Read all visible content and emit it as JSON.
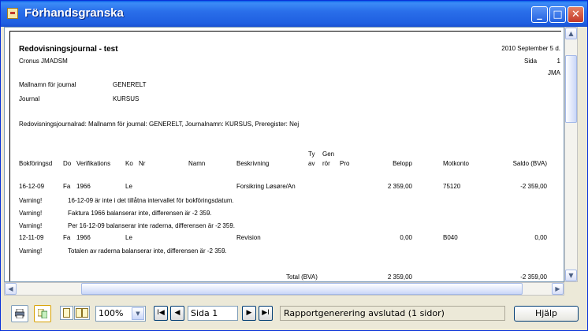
{
  "window": {
    "title": "Förhandsgranska",
    "min_label": "_",
    "max_label": "□",
    "close_label": "✕"
  },
  "report": {
    "title": "Redovisningsjournal - test",
    "company": "Cronus JMADSM",
    "date": "2010 September 5 d.",
    "page_label": "Sida",
    "page_number": "1",
    "user": "JMA",
    "template_label": "Mallnamn för journal",
    "template_value": "GENERELT",
    "journal_label": "Journal",
    "journal_value": "KURSUS",
    "filter": "Redovisningsjournalrad: Mallnamn för journal: GENERELT, Journalnamn: KURSUS, Preregister: Nej",
    "headers": {
      "date": "Bokföringsd",
      "doc": "Do",
      "verif": "Verifikations",
      "ko": "Ko",
      "nr": "Nr",
      "name": "Namn",
      "desc": "Beskrivning",
      "type_top": "Ty",
      "type_bottom": "av",
      "gen_top": "Gen",
      "gen_bottom": "rör",
      "pro": "Pro",
      "amount": "Belopp",
      "contra": "Motkonto",
      "balance": "Saldo (BVA)"
    },
    "rows": [
      {
        "date": "16-12-09",
        "doc": "Fa",
        "verif": "1966",
        "ko": "Le",
        "desc": "Forsikring Løsøre/An",
        "amount": "2 359,00",
        "contra": "75120",
        "balance": "-2 359,00"
      },
      {
        "date": "12-11-09",
        "doc": "Fa",
        "verif": "1966",
        "ko": "Le",
        "desc": "Revision",
        "amount": "0,00",
        "contra": "B040",
        "balance": "0,00"
      }
    ],
    "warning_label": "Varning!",
    "warnings": [
      "16-12-09 är inte i det tillåtna intervallet för bokföringsdatum.",
      "Faktura 1966 balanserar inte, differensen är -2 359.",
      "Per 16-12-09 balanserar inte raderna, differensen är -2 359.",
      "Totalen av raderna balanserar inte, differensen är -2 359."
    ],
    "total_label": "Total (BVA)",
    "total_amount": "2 359,00",
    "total_balance": "-2 359,00"
  },
  "toolbar": {
    "zoom": "100%",
    "page_field": "Sida 1",
    "status": "Rapportgenerering avslutad (1 sidor)",
    "help_label": "Hjälp",
    "first_glyph": "I◀",
    "prev_glyph": "◀",
    "next_glyph": "▶",
    "last_glyph": "▶I"
  },
  "icons": [
    "print-icon",
    "export-icon",
    "one-page-icon",
    "two-page-icon"
  ]
}
